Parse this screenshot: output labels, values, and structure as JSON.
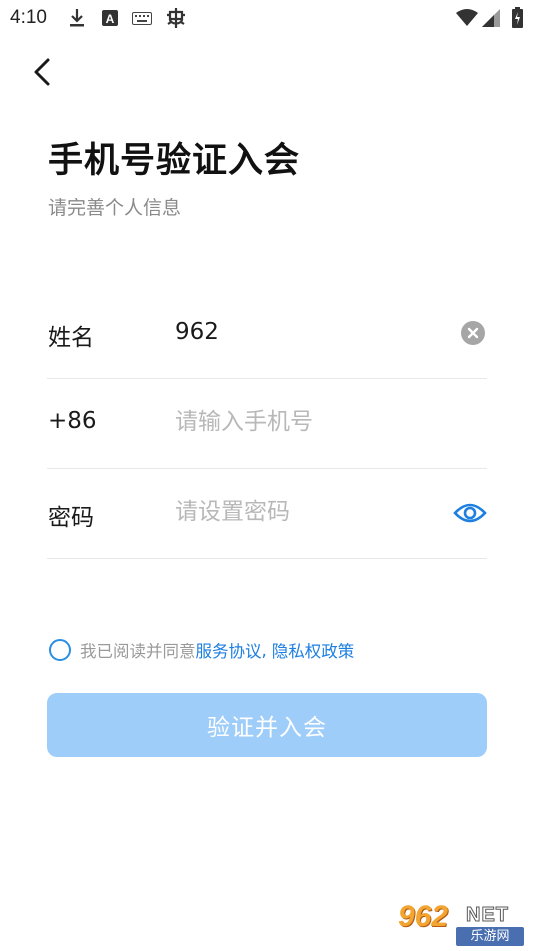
{
  "status_bar": {
    "time": "4:10",
    "left_icons": [
      "download-icon",
      "a-notification-icon",
      "keyboard-icon",
      "bug-icon"
    ],
    "right_icons": [
      "wifi-icon",
      "signal-icon",
      "battery-icon"
    ]
  },
  "header": {
    "back_icon": "chevron-left-icon",
    "title": "手机号验证入会",
    "subtitle": "请完善个人信息"
  },
  "form": {
    "name": {
      "label": "姓名",
      "value": "962",
      "clear_icon": "clear-icon"
    },
    "phone": {
      "label": "+86",
      "placeholder": "请输入手机号",
      "value": ""
    },
    "password": {
      "label": "密码",
      "placeholder": "请设置密码",
      "value": "",
      "toggle_icon": "eye-icon"
    }
  },
  "agreement": {
    "prefix": "我已阅读并同意",
    "link1": "服务协议",
    "separator": ",",
    "link2": "隐私权政策",
    "checked": false
  },
  "submit": {
    "label": "验证并入会",
    "color": "#9fcdfa"
  },
  "colors": {
    "accent": "#1d7fe0",
    "placeholder": "#b8b8b8"
  },
  "watermark": {
    "number": "962",
    "net": "NET",
    "chinese": "乐游网"
  }
}
